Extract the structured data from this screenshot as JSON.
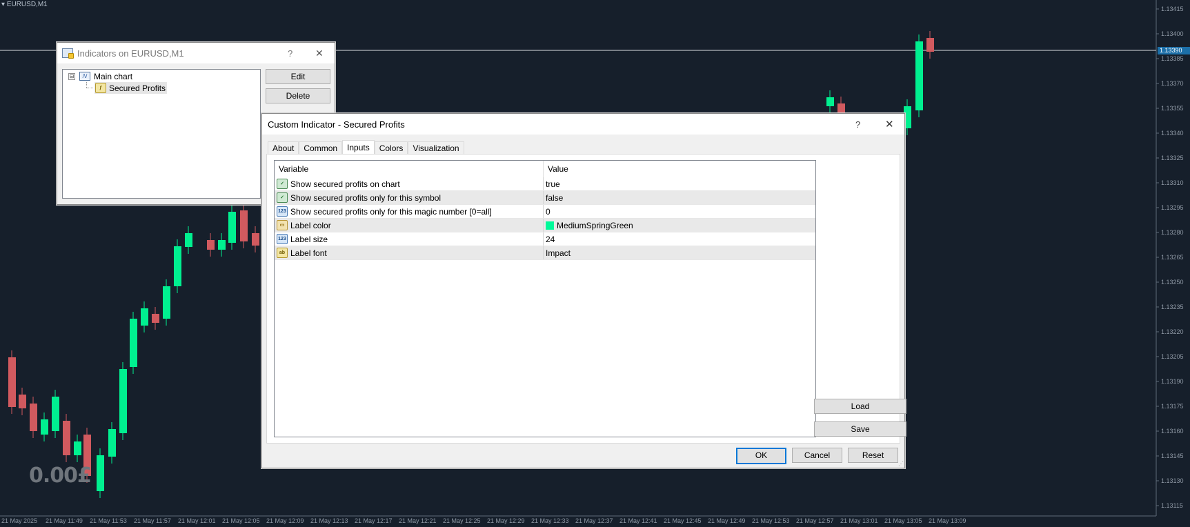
{
  "chart": {
    "symbol": "EURUSD,M1",
    "profit_label": "0.00£",
    "current_price": "1.13390",
    "price_ticks": [
      "1.13415",
      "1.13400",
      "1.13385",
      "1.13370",
      "1.13355",
      "1.13340",
      "1.13325",
      "1.13310",
      "1.13295",
      "1.13280",
      "1.13265",
      "1.13250",
      "1.13235",
      "1.13220",
      "1.13205",
      "1.13190",
      "1.13175",
      "1.13160",
      "1.13145",
      "1.13130",
      "1.13115"
    ],
    "time_ticks": [
      "21 May 2025",
      "21 May 11:49",
      "21 May 11:53",
      "21 May 11:57",
      "21 May 12:01",
      "21 May 12:05",
      "21 May 12:09",
      "21 May 12:13",
      "21 May 12:17",
      "21 May 12:21",
      "21 May 12:25",
      "21 May 12:29",
      "21 May 12:33",
      "21 May 12:37",
      "21 May 12:41",
      "21 May 12:45",
      "21 May 12:49",
      "21 May 12:53",
      "21 May 12:57",
      "21 May 13:01",
      "21 May 13:05",
      "21 May 13:09"
    ],
    "colors": {
      "background": "#161f2b",
      "bull": "#00f090",
      "bear": "#d15a5f",
      "axis_text": "#8f99a5"
    }
  },
  "indicators_window": {
    "title": "Indicators on EURUSD,M1",
    "help": "?",
    "close": "✕",
    "tree": {
      "root": "Main chart",
      "child": "Secured Profits",
      "expander": "⊟"
    },
    "buttons": {
      "edit": "Edit",
      "delete": "Delete"
    }
  },
  "custom_indicator": {
    "title": "Custom Indicator - Secured Profits",
    "help": "?",
    "close": "✕",
    "tabs": [
      "About",
      "Common",
      "Inputs",
      "Colors",
      "Visualization"
    ],
    "active_tab": "Inputs",
    "columns": {
      "variable": "Variable",
      "value": "Value"
    },
    "inputs": [
      {
        "variable": "Show secured profits on chart",
        "value": "true",
        "icon": "bool",
        "glyph": "✓"
      },
      {
        "variable": "Show secured profits only for this symbol",
        "value": "false",
        "icon": "bool",
        "glyph": "✓"
      },
      {
        "variable": "Show secured profits only for this magic number [0=all]",
        "value": "0",
        "icon": "num",
        "glyph": "123"
      },
      {
        "variable": "Label color",
        "value": "MediumSpringGreen",
        "icon": "color",
        "glyph": "▭",
        "swatch": "#00fa9a"
      },
      {
        "variable": "Label size",
        "value": "24",
        "icon": "num",
        "glyph": "123"
      },
      {
        "variable": "Label font",
        "value": "Impact",
        "icon": "str",
        "glyph": "ab"
      }
    ],
    "side_buttons": {
      "load": "Load",
      "save": "Save"
    },
    "footer_buttons": {
      "ok": "OK",
      "cancel": "Cancel",
      "reset": "Reset"
    }
  }
}
